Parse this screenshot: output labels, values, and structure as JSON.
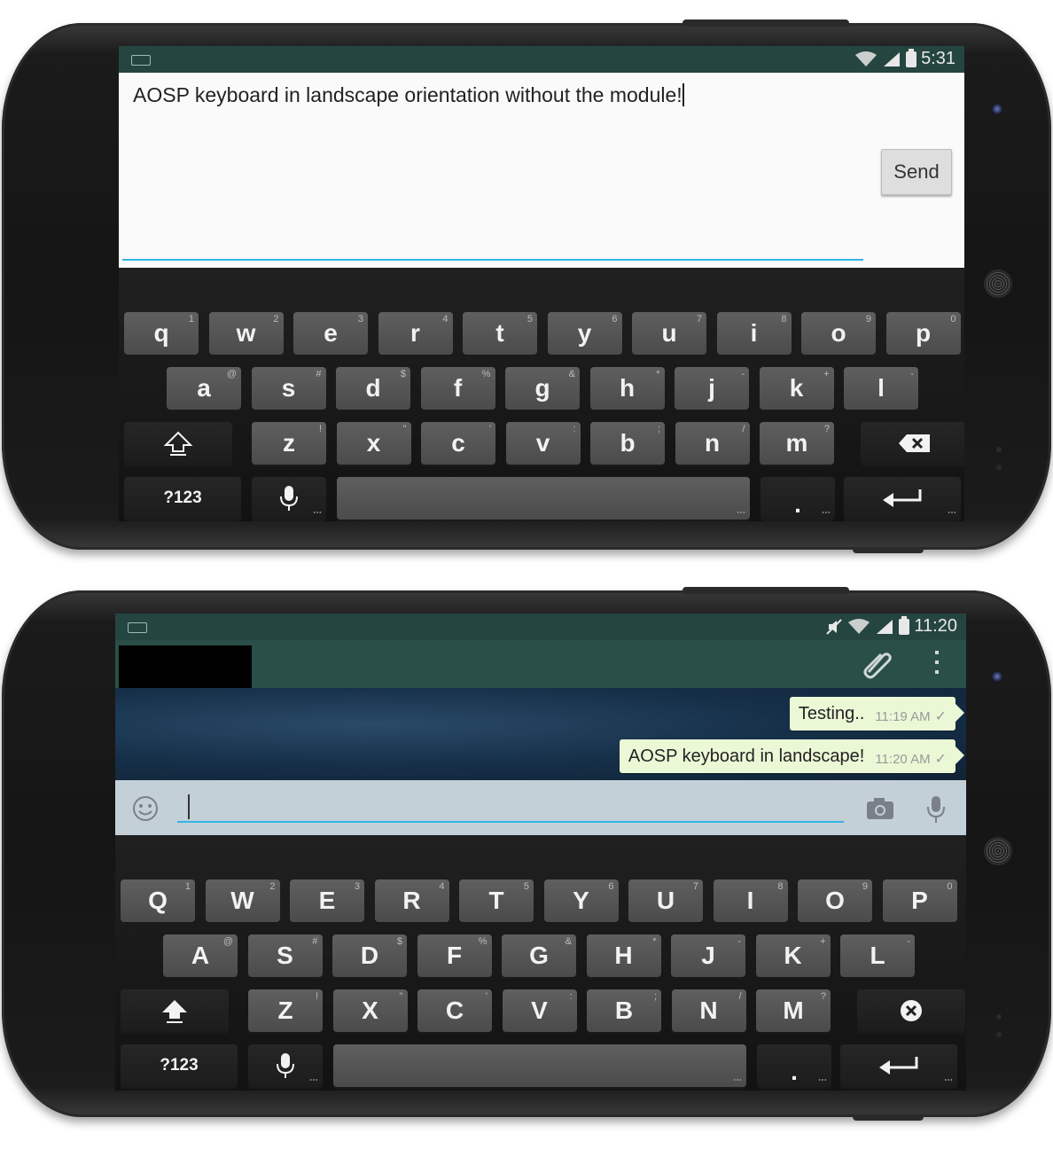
{
  "top_phone": {
    "status_time": "5:31",
    "edit_text": "AOSP keyboard in landscape orientation without the module!",
    "send_label": "Send",
    "keyboard": {
      "row1": [
        {
          "label": "q",
          "hint": "1"
        },
        {
          "label": "w",
          "hint": "2"
        },
        {
          "label": "e",
          "hint": "3"
        },
        {
          "label": "r",
          "hint": "4"
        },
        {
          "label": "t",
          "hint": "5"
        },
        {
          "label": "y",
          "hint": "6"
        },
        {
          "label": "u",
          "hint": "7"
        },
        {
          "label": "i",
          "hint": "8"
        },
        {
          "label": "o",
          "hint": "9"
        },
        {
          "label": "p",
          "hint": "0"
        }
      ],
      "row2": [
        {
          "label": "a",
          "hint": "@"
        },
        {
          "label": "s",
          "hint": "#"
        },
        {
          "label": "d",
          "hint": "$"
        },
        {
          "label": "f",
          "hint": "%"
        },
        {
          "label": "g",
          "hint": "&"
        },
        {
          "label": "h",
          "hint": "*"
        },
        {
          "label": "j",
          "hint": "-"
        },
        {
          "label": "k",
          "hint": "+"
        },
        {
          "label": "l",
          "hint": "-"
        }
      ],
      "row3": [
        {
          "label": "z",
          "hint": "!"
        },
        {
          "label": "x",
          "hint": "\""
        },
        {
          "label": "c",
          "hint": "'"
        },
        {
          "label": "v",
          "hint": ":"
        },
        {
          "label": "b",
          "hint": ";"
        },
        {
          "label": "n",
          "hint": "/"
        },
        {
          "label": "m",
          "hint": "?"
        }
      ],
      "symbols_label": "?123",
      "period_label": "."
    }
  },
  "bottom_phone": {
    "status_time": "11:20",
    "messages": [
      {
        "text": "Testing..",
        "time": "11:19 AM"
      },
      {
        "text": "AOSP keyboard in landscape!",
        "time": "11:20 AM"
      }
    ],
    "keyboard": {
      "row1": [
        {
          "label": "Q",
          "hint": "1"
        },
        {
          "label": "W",
          "hint": "2"
        },
        {
          "label": "E",
          "hint": "3"
        },
        {
          "label": "R",
          "hint": "4"
        },
        {
          "label": "T",
          "hint": "5"
        },
        {
          "label": "Y",
          "hint": "6"
        },
        {
          "label": "U",
          "hint": "7"
        },
        {
          "label": "I",
          "hint": "8"
        },
        {
          "label": "O",
          "hint": "9"
        },
        {
          "label": "P",
          "hint": "0"
        }
      ],
      "row2": [
        {
          "label": "A",
          "hint": "@"
        },
        {
          "label": "S",
          "hint": "#"
        },
        {
          "label": "D",
          "hint": "$"
        },
        {
          "label": "F",
          "hint": "%"
        },
        {
          "label": "G",
          "hint": "&"
        },
        {
          "label": "H",
          "hint": "*"
        },
        {
          "label": "J",
          "hint": "-"
        },
        {
          "label": "K",
          "hint": "+"
        },
        {
          "label": "L",
          "hint": "-"
        }
      ],
      "row3": [
        {
          "label": "Z",
          "hint": "!"
        },
        {
          "label": "X",
          "hint": "\""
        },
        {
          "label": "C",
          "hint": "'"
        },
        {
          "label": "V",
          "hint": ":"
        },
        {
          "label": "B",
          "hint": ";"
        },
        {
          "label": "N",
          "hint": "/"
        },
        {
          "label": "M",
          "hint": "?"
        }
      ],
      "symbols_label": "?123",
      "period_label": "."
    }
  }
}
